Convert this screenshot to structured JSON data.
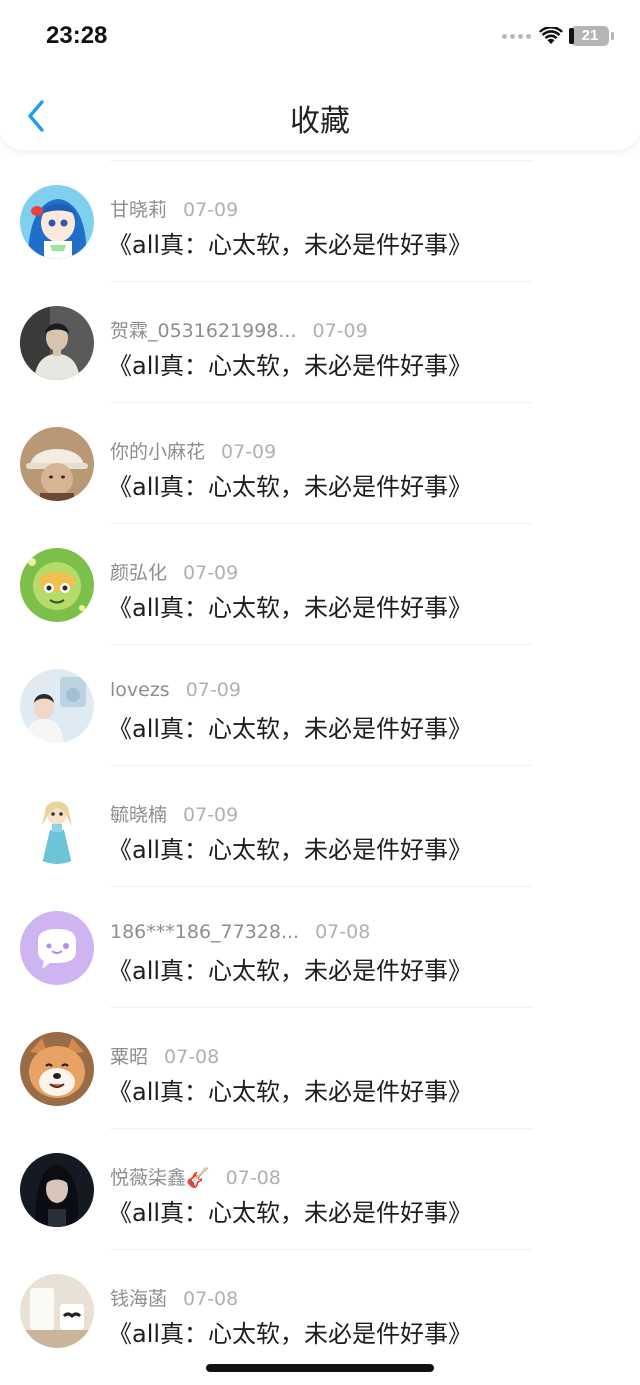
{
  "status": {
    "time": "23:28",
    "battery": "21"
  },
  "nav": {
    "title": "收藏"
  },
  "favorites": [
    {
      "user": "甘晓莉",
      "date": "07-09",
      "title": "《all真：心太软，未必是件好事》",
      "avatar": "anime-girl"
    },
    {
      "user": "贺霖_0531621998...",
      "date": "07-09",
      "title": "《all真：心太软，未必是件好事》",
      "avatar": "boy-photo"
    },
    {
      "user": "你的小麻花",
      "date": "07-09",
      "title": "《all真：心太软，未必是件好事》",
      "avatar": "hat-photo"
    },
    {
      "user": "颜弘化",
      "date": "07-09",
      "title": "《all真：心太软，未必是件好事》",
      "avatar": "green-cartoon"
    },
    {
      "user": "lovezs",
      "date": "07-09",
      "title": "《all真：心太软，未必是件好事》",
      "avatar": "light-photo"
    },
    {
      "user": "毓晓楠",
      "date": "07-09",
      "title": "《all真：心太软，未必是件好事》",
      "avatar": "elsa-cartoon"
    },
    {
      "user": "186***186_77328...",
      "date": "07-08",
      "title": "《all真：心太软，未必是件好事》",
      "avatar": "default-chat"
    },
    {
      "user": "粟昭",
      "date": "07-08",
      "title": "《all真：心太软，未必是件好事》",
      "avatar": "shiba-dog"
    },
    {
      "user": "悦薇柒鑫🎸",
      "date": "07-08",
      "title": "《all真：心太软，未必是件好事》",
      "avatar": "dark-portrait"
    },
    {
      "user": "钱海菡",
      "date": "07-08",
      "title": "《all真：心太软，未必是件好事》",
      "avatar": "cups-photo"
    }
  ],
  "colors": {
    "accent": "#1e9ef0",
    "meta": "#8e8e8e",
    "date": "#b0b0b0",
    "text": "#1e1e1e"
  }
}
